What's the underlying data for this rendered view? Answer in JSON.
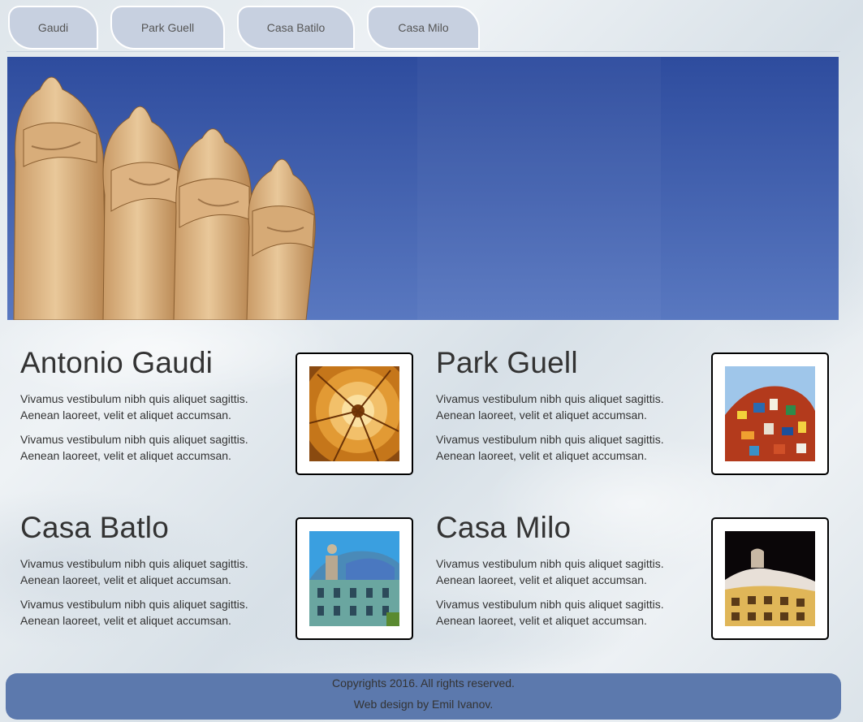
{
  "nav": {
    "tabs": [
      {
        "label": "Gaudi"
      },
      {
        "label": "Park Guell"
      },
      {
        "label": "Casa Batilo"
      },
      {
        "label": "Casa Milo"
      }
    ]
  },
  "sections": [
    {
      "title": "Antonio Gaudi",
      "p1": "Vivamus vestibulum nibh quis aliquet sagittis. Aenean laoreet, velit et aliquet accumsan.",
      "p2": "Vivamus vestibulum nibh quis aliquet sagittis. Aenean laoreet, velit et aliquet accumsan."
    },
    {
      "title": "Park Guell",
      "p1": "Vivamus vestibulum nibh quis aliquet sagittis. Aenean laoreet, velit et aliquet accumsan.",
      "p2": "Vivamus vestibulum nibh quis aliquet sagittis. Aenean laoreet, velit et aliquet accumsan."
    },
    {
      "title": "Casa Batlo",
      "p1": "Vivamus vestibulum nibh quis aliquet sagittis. Aenean laoreet, velit et aliquet accumsan.",
      "p2": "Vivamus vestibulum nibh quis aliquet sagittis. Aenean laoreet, velit et aliquet accumsan."
    },
    {
      "title": "Casa Milo",
      "p1": "Vivamus vestibulum nibh quis aliquet sagittis. Aenean laoreet, velit et aliquet accumsan.",
      "p2": "Vivamus vestibulum nibh quis aliquet sagittis. Aenean laoreet, velit et aliquet accumsan."
    }
  ],
  "footer": {
    "copyright": "Copyrights 2016. All rights reserved.",
    "credit": "Web design by Emil Ivanov."
  },
  "colors": {
    "tab_bg": "#c7d0e0",
    "footer_bg": "#5c79ad",
    "sky": "#3a5aad"
  }
}
